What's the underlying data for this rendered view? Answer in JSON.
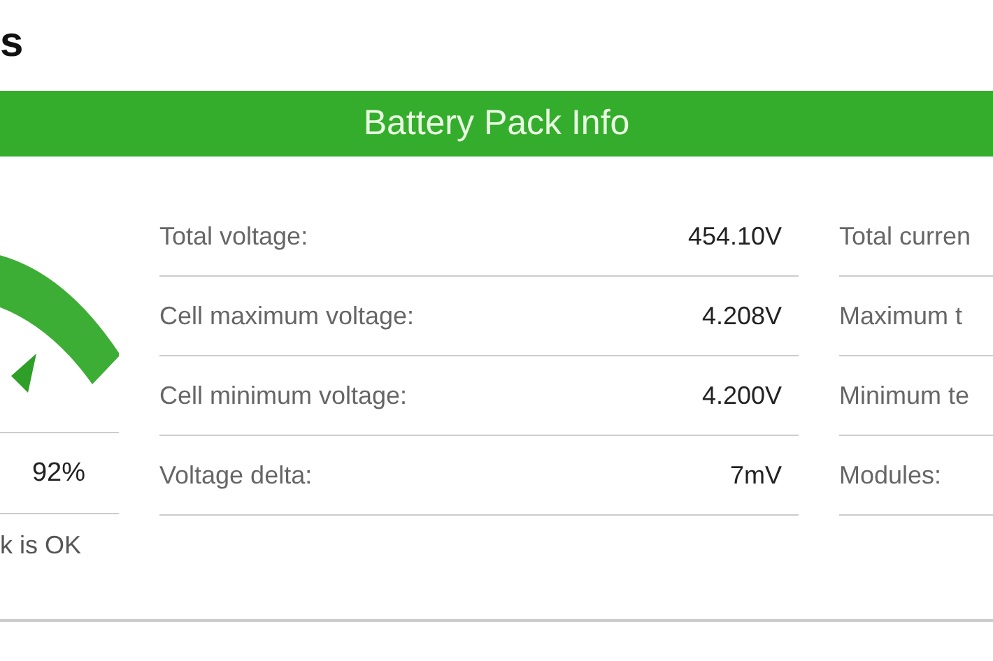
{
  "page_title": "s",
  "header": {
    "title": "Battery Pack Info"
  },
  "summary": {
    "value": "92%",
    "status": "k is OK"
  },
  "voltages": [
    {
      "label": "Total voltage:",
      "value": "454.10V"
    },
    {
      "label": "Cell maximum voltage:",
      "value": "4.208V"
    },
    {
      "label": "Cell minimum voltage:",
      "value": "4.200V"
    },
    {
      "label": "Voltage delta:",
      "value": "7mV"
    }
  ],
  "other": [
    {
      "label": "Total curren"
    },
    {
      "label": "Maximum t"
    },
    {
      "label": "Minimum te"
    },
    {
      "label": "Modules:"
    }
  ]
}
